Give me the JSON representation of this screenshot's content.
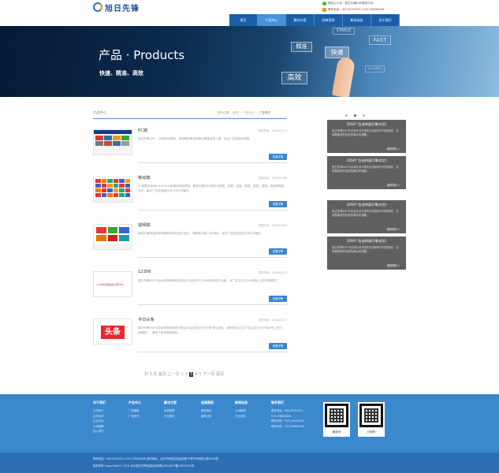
{
  "header": {
    "logo_text": "旭日先锋",
    "wechat_text": "微信公众号：旭日先锋DSP服务平台",
    "phone_text": "联系电话：400-876-8511    010-53806006"
  },
  "nav": {
    "items": [
      "首页",
      "产品中心",
      "解决方案",
      "经典案例",
      "新闻动态",
      "关于我们"
    ],
    "active_index": 1,
    "dropdown": [
      "广告展现",
      "广告形式"
    ]
  },
  "banner": {
    "title": "产品 · Products",
    "subtitle": "快速、精准、高效",
    "tags": [
      "STABLE",
      "FAST",
      "精准",
      "快速",
      "高效",
      "SECURITY"
    ]
  },
  "section": {
    "title": "产品中心",
    "breadcrumb_prefix": "您的位置：",
    "breadcrumb_home": "首页",
    "breadcrumb_sep": "〉",
    "breadcrumb_mid": "产品中心",
    "breadcrumb_current": "广告形式"
  },
  "products": [
    {
      "title": "PC端",
      "date": "发布时间：2016/01/13",
      "desc": "旭日先锋以PC、手机移动网络、视频网站等多种媒介覆盖全网人群，保证广告投放的效果。",
      "button": "查看详情"
    },
    {
      "title": "移动端",
      "date": "发布时间：2016/02/09",
      "desc": "PC端整合全网1,600,000家媒体网站资源，覆盖中国98%网民与精英。份额、百度、网易、新浪、搜狐、淘宝等网站合作，每天广告投放量可达100亿次曝光。",
      "button": "查看详情"
    },
    {
      "title": "视频端",
      "date": "发布时间：2016/01/20",
      "desc": "链接方面精选多家视频媒体网站进行合作，可覆盖中国4.5亿网民，每天广告投放量多达8亿次曝光!",
      "button": "查看详情"
    },
    {
      "title": "12306",
      "date": "发布时间：2016/01/13",
      "desc": "旭日先锋DSP平台私有媒体程序化购买平台及时与12306官网进行对接，为广告主在12306网站上进行网络推广。",
      "button": "查看详情"
    },
    {
      "title": "今日头条",
      "date": "发布时间：2016/01/11",
      "desc": "旭日先锋DSP平台私有媒体程序化购买平台及时与今日头条进行对接，以程序化方式为广告主在今日头条APP上进行网络推广，避免了私有媒体购买...",
      "button": "查看详情"
    }
  ],
  "thumb_texts": [
    "12306中国铁路客户服务中心",
    "头条"
  ],
  "pager": {
    "prefix": "共 5 页 首页 上一页",
    "pages": [
      "1",
      "2",
      "3",
      "4",
      "5"
    ],
    "current_index": 2,
    "suffix": "下一页 尾页"
  },
  "side_cards": [
    {
      "title": "《DSP广告选择展引擎对比》",
      "desc": "旭日先锋DSP平台将针对不同的计划制作不同的素材，并依据素材的投放效果实时调整...",
      "more": "查看详情 >"
    },
    {
      "title": "《DSP广告选择展引擎对比》",
      "desc": "旭日先锋DSP平台将针对不同的计划制作不同的素材，并依据素材的投放效果实时调整...",
      "more": "查看详情 >"
    },
    {
      "title": "《DSP广告选择展引擎对比》",
      "desc": "旭日先锋DSP平台将针对不同的计划制作不同的素材，并依据素材的投放效果实时调整...",
      "more": "查看详情 >"
    },
    {
      "title": "《DSP广告选择展引擎对比》",
      "desc": "旭日先锋DSP平台将针对不同的计划制作不同的素材，并依据素材的投放效果实时调整...",
      "more": "查看详情 >"
    }
  ],
  "footer": {
    "columns": [
      {
        "head": "关于我们",
        "items": [
          "公司简介",
          "合作伙伴",
          "企业文化",
          "公司招聘",
          "加入我们"
        ]
      },
      {
        "head": "产品中心",
        "items": [
          "广告展现",
          "广告形式"
        ]
      },
      {
        "head": "解决方案",
        "items": [
          "投放原理",
          "行业解决"
        ]
      },
      {
        "head": "经典案例",
        "items": [
          "案例展示",
          "案例分析"
        ]
      },
      {
        "head": "新闻动态",
        "items": [
          "公司新闻",
          "行业动态"
        ]
      },
      {
        "head": "联系我们",
        "items": [
          "联系电话：400-876-8511",
          "010-53806006",
          "联系手机：010-59425292",
          "联系传真：010-53806006"
        ]
      }
    ],
    "qr_labels": [
      "服务号",
      "订阅号"
    ]
  },
  "bottom": {
    "line1": "联系电话：400-876-8511    010-53806006        通讯地址：北京市海淀区奥运街路19号时代网络大厦4006室",
    "line2": "版权所有 Copyright(C) 2016 北京旭日先锋信息技术有限公司 京ICP备15030915号"
  },
  "colors": {
    "nav_blue": "#1a5fa8",
    "nav_active": "#4593d9",
    "footer_blue": "#3c88cd",
    "button_blue": "#3d84cb"
  }
}
